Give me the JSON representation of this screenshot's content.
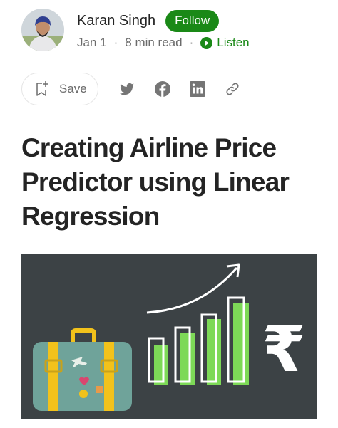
{
  "author": {
    "name": "Karan Singh",
    "follow_label": "Follow",
    "avatar_icon": "person-avatar"
  },
  "meta": {
    "date": "Jan 1",
    "separator": "·",
    "read_time": "8 min read",
    "listen_label": "Listen"
  },
  "actions": {
    "save_label": "Save",
    "icons": [
      "save-add-icon",
      "twitter-icon",
      "facebook-icon",
      "linkedin-icon",
      "link-icon"
    ]
  },
  "article": {
    "title": "Creating Airline Price Predictor using Linear Regression",
    "hero_symbol": "₹"
  },
  "colors": {
    "brand_green": "#1a8917",
    "text_primary": "#242424",
    "text_secondary": "#6b6b6b",
    "icon_gray": "#757575",
    "hero_background": "#3c4245",
    "bar_green": "#7dd957",
    "suitcase_teal": "#6fa39a",
    "strap_yellow": "#f2c21b"
  }
}
